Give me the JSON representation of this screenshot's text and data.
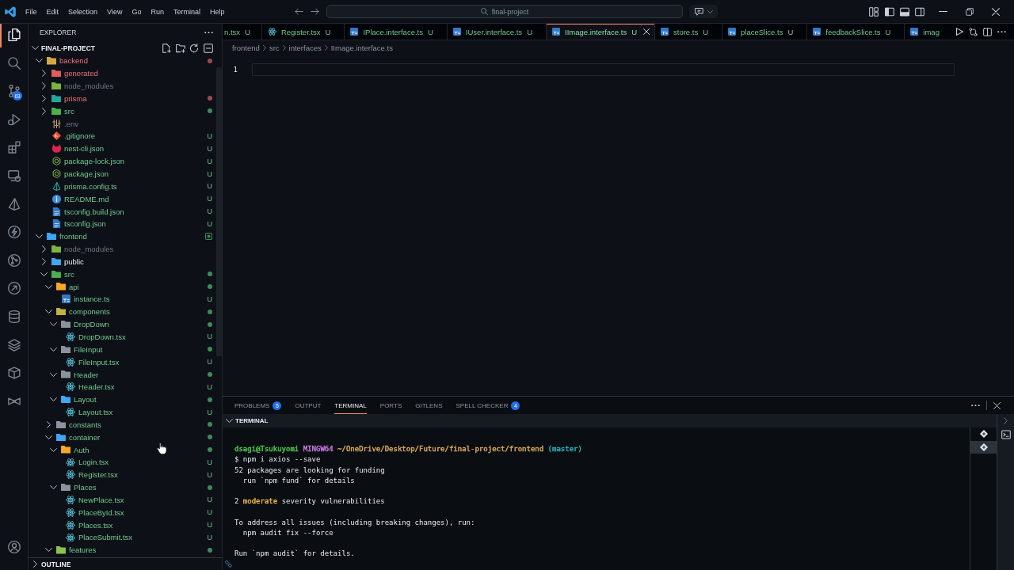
{
  "title_bar": {
    "menu": [
      "File",
      "Edit",
      "Selection",
      "View",
      "Go",
      "Run",
      "Terminal",
      "Help"
    ],
    "command_center": {
      "label": "final-project"
    }
  },
  "activity_bar": {
    "items": [
      {
        "selected": true
      },
      {
        "selected": false
      },
      {
        "selected": false,
        "badge": "63"
      },
      {
        "selected": false
      },
      {
        "selected": false
      },
      {
        "selected": false
      },
      {
        "selected": false
      },
      {
        "selected": false
      },
      {
        "selected": false
      },
      {
        "selected": false
      },
      {
        "selected": false
      },
      {
        "selected": false
      },
      {
        "selected": false
      },
      {
        "selected": false
      }
    ]
  },
  "explorer": {
    "title": "EXPLORER",
    "project": {
      "label": "FINAL-PROJECT",
      "expanded": true
    },
    "tree": [
      {
        "name": "backend",
        "kind": "folder",
        "color": "#d9a740",
        "expanded": true,
        "untracked": false,
        "ignored": false,
        "error": true,
        "dot": true,
        "boxed": false,
        "children": [
          {
            "name": "generated",
            "kind": "folder",
            "color": "#e05d5d",
            "expanded": false,
            "untracked": false,
            "ignored": false,
            "error": true,
            "dot": false,
            "boxed": false
          },
          {
            "name": "node_modules",
            "kind": "folder",
            "color": "#7cb342",
            "expanded": false,
            "untracked": false,
            "ignored": true,
            "error": false,
            "dot": false,
            "boxed": false
          },
          {
            "name": "prisma",
            "kind": "folder",
            "color": "#26a69a",
            "expanded": false,
            "untracked": false,
            "ignored": false,
            "error": true,
            "dot": true,
            "boxed": false
          },
          {
            "name": "src",
            "kind": "folder",
            "color": "#4caf50",
            "expanded": false,
            "untracked": true,
            "ignored": false,
            "error": false,
            "dot": true,
            "boxed": false
          },
          {
            "name": ".env",
            "kind": "env",
            "untracked": false,
            "ignored": true,
            "error": false,
            "dot": false,
            "boxed": false
          },
          {
            "name": ".gitignore",
            "kind": "git",
            "untracked": true,
            "ignored": false,
            "error": false,
            "dot": false,
            "boxed": false,
            "badge": "U"
          },
          {
            "name": "nest-cli.json",
            "kind": "nest",
            "untracked": true,
            "ignored": false,
            "error": false,
            "dot": false,
            "boxed": false,
            "badge": "U"
          },
          {
            "name": "package-lock.json",
            "kind": "npm",
            "untracked": true,
            "ignored": false,
            "error": false,
            "dot": false,
            "boxed": false,
            "badge": "U"
          },
          {
            "name": "package.json",
            "kind": "npm",
            "untracked": true,
            "ignored": false,
            "error": false,
            "dot": false,
            "boxed": false,
            "badge": "U"
          },
          {
            "name": "prisma.config.ts",
            "kind": "prisma",
            "untracked": true,
            "ignored": false,
            "error": false,
            "dot": false,
            "boxed": false,
            "badge": "U"
          },
          {
            "name": "README.md",
            "kind": "info",
            "untracked": true,
            "ignored": false,
            "error": false,
            "dot": false,
            "boxed": false,
            "badge": "U"
          },
          {
            "name": "tsconfig.build.json",
            "kind": "tsconfig",
            "untracked": true,
            "ignored": false,
            "error": false,
            "dot": false,
            "boxed": false,
            "badge": "U"
          },
          {
            "name": "tsconfig.json",
            "kind": "tsconfig",
            "untracked": true,
            "ignored": false,
            "error": false,
            "dot": false,
            "boxed": false,
            "badge": "U"
          }
        ]
      },
      {
        "name": "frontend",
        "kind": "folder",
        "color": "#42a5f5",
        "expanded": true,
        "untracked": true,
        "ignored": false,
        "error": false,
        "dot": true,
        "boxed": true,
        "children": [
          {
            "name": "node_modules",
            "kind": "folder",
            "color": "#7cb342",
            "expanded": false,
            "untracked": false,
            "ignored": true,
            "error": false,
            "dot": false,
            "boxed": false
          },
          {
            "name": "public",
            "kind": "folder",
            "color": "#42a5f5",
            "expanded": false,
            "untracked": false,
            "ignored": false,
            "error": false,
            "dot": false,
            "boxed": false
          },
          {
            "name": "src",
            "kind": "folder",
            "color": "#4caf50",
            "expanded": true,
            "untracked": true,
            "ignored": false,
            "error": false,
            "dot": true,
            "boxed": false,
            "children": [
              {
                "name": "api",
                "kind": "folder",
                "color": "#f9a825",
                "expanded": true,
                "untracked": true,
                "ignored": false,
                "error": false,
                "dot": true,
                "boxed": false,
                "children": [
                  {
                    "name": "instance.ts",
                    "kind": "ts",
                    "untracked": true,
                    "ignored": false,
                    "error": false,
                    "dot": false,
                    "boxed": false,
                    "badge": "U"
                  }
                ]
              },
              {
                "name": "components",
                "kind": "folder",
                "color": "#c0b341",
                "expanded": true,
                "untracked": true,
                "ignored": false,
                "error": false,
                "dot": true,
                "boxed": false,
                "children": [
                  {
                    "name": "DropDown",
                    "kind": "folder",
                    "color": "#8b949e",
                    "expanded": true,
                    "untracked": true,
                    "ignored": false,
                    "error": false,
                    "dot": true,
                    "boxed": false,
                    "children": [
                      {
                        "name": "DropDown.tsx",
                        "kind": "react",
                        "untracked": true,
                        "ignored": false,
                        "error": false,
                        "dot": false,
                        "boxed": false,
                        "badge": "U"
                      }
                    ]
                  },
                  {
                    "name": "FileInput",
                    "kind": "folder",
                    "color": "#8b949e",
                    "expanded": true,
                    "untracked": true,
                    "ignored": false,
                    "error": false,
                    "dot": true,
                    "boxed": false,
                    "children": [
                      {
                        "name": "FileInput.tsx",
                        "kind": "react",
                        "untracked": true,
                        "ignored": false,
                        "error": false,
                        "dot": false,
                        "boxed": false,
                        "badge": "U"
                      }
                    ]
                  },
                  {
                    "name": "Header",
                    "kind": "folder",
                    "color": "#8b949e",
                    "expanded": true,
                    "untracked": true,
                    "ignored": false,
                    "error": false,
                    "dot": true,
                    "boxed": false,
                    "children": [
                      {
                        "name": "Header.tsx",
                        "kind": "react",
                        "untracked": true,
                        "ignored": false,
                        "error": false,
                        "dot": false,
                        "boxed": false,
                        "badge": "U"
                      }
                    ]
                  },
                  {
                    "name": "Layout",
                    "kind": "folder",
                    "color": "#42a5f5",
                    "expanded": true,
                    "untracked": true,
                    "ignored": false,
                    "error": false,
                    "dot": true,
                    "boxed": false,
                    "children": [
                      {
                        "name": "Layout.tsx",
                        "kind": "react",
                        "untracked": true,
                        "ignored": false,
                        "error": false,
                        "dot": false,
                        "boxed": false,
                        "badge": "U"
                      }
                    ]
                  }
                ]
              },
              {
                "name": "constants",
                "kind": "folder",
                "color": "#8b949e",
                "expanded": false,
                "untracked": true,
                "ignored": false,
                "error": false,
                "dot": true,
                "boxed": false
              },
              {
                "name": "container",
                "kind": "folder",
                "color": "#42a5f5",
                "expanded": true,
                "untracked": true,
                "ignored": false,
                "error": false,
                "dot": true,
                "boxed": false,
                "children": [
                  {
                    "name": "Auth",
                    "kind": "folder",
                    "color": "#f9a825",
                    "expanded": true,
                    "untracked": true,
                    "ignored": false,
                    "error": false,
                    "dot": true,
                    "boxed": false,
                    "children": [
                      {
                        "name": "Login.tsx",
                        "kind": "react",
                        "untracked": true,
                        "ignored": false,
                        "error": false,
                        "dot": false,
                        "boxed": false,
                        "badge": "U"
                      },
                      {
                        "name": "Register.tsx",
                        "kind": "react",
                        "untracked": true,
                        "ignored": false,
                        "error": false,
                        "dot": false,
                        "boxed": false,
                        "badge": "U"
                      }
                    ]
                  },
                  {
                    "name": "Places",
                    "kind": "folder",
                    "color": "#8b949e",
                    "expanded": true,
                    "untracked": true,
                    "ignored": false,
                    "error": false,
                    "dot": true,
                    "boxed": false,
                    "children": [
                      {
                        "name": "NewPlace.tsx",
                        "kind": "react",
                        "untracked": true,
                        "ignored": false,
                        "error": false,
                        "dot": false,
                        "boxed": false,
                        "badge": "U"
                      },
                      {
                        "name": "PlaceById.tsx",
                        "kind": "react",
                        "untracked": true,
                        "ignored": false,
                        "error": false,
                        "dot": false,
                        "boxed": false,
                        "badge": "U"
                      },
                      {
                        "name": "Places.tsx",
                        "kind": "react",
                        "untracked": true,
                        "ignored": false,
                        "error": false,
                        "dot": false,
                        "boxed": false,
                        "badge": "U"
                      },
                      {
                        "name": "PlaceSubmit.tsx",
                        "kind": "react",
                        "untracked": true,
                        "ignored": false,
                        "error": false,
                        "dot": false,
                        "boxed": false,
                        "badge": "U"
                      }
                    ]
                  }
                ]
              },
              {
                "name": "features",
                "kind": "folder",
                "color": "#8bc34a",
                "expanded": true,
                "untracked": true,
                "ignored": false,
                "error": false,
                "dot": true,
                "boxed": false
              }
            ]
          }
        ]
      }
    ],
    "outline": {
      "label": "OUTLINE",
      "expanded": false
    }
  },
  "editor": {
    "tabs": [
      {
        "label": "n.tsx",
        "untracked": true,
        "badge": "U",
        "selected": false
      },
      {
        "label": "Register.tsx",
        "kind": "react",
        "untracked": true,
        "badge": "U",
        "selected": false
      },
      {
        "label": "IPlace.interface.ts",
        "kind": "ts",
        "untracked": true,
        "badge": "U",
        "selected": false
      },
      {
        "label": "IUser.interface.ts",
        "kind": "ts",
        "untracked": true,
        "badge": "U",
        "selected": false
      },
      {
        "label": "IImage.interface.ts",
        "kind": "ts",
        "untracked": true,
        "badge": "U",
        "selected": true
      },
      {
        "label": "store.ts",
        "kind": "ts",
        "untracked": true,
        "badge": "U",
        "selected": false
      },
      {
        "label": "placeSlice.ts",
        "kind": "ts",
        "untracked": true,
        "badge": "U",
        "selected": false
      },
      {
        "label": "feedbackSlice.ts",
        "kind": "ts",
        "untracked": true,
        "badge": "U",
        "selected": false
      },
      {
        "label": "imag",
        "kind": "ts",
        "untracked": true,
        "selected": false
      }
    ],
    "breadcrumbs": [
      "frontend",
      "src",
      "interfaces",
      "IImage.interface.ts"
    ],
    "lines": [
      {
        "number": "1",
        "current": true
      }
    ]
  },
  "panel": {
    "tabs": [
      {
        "label": "PROBLEMS",
        "badge": "5",
        "selected": false
      },
      {
        "label": "OUTPUT",
        "selected": false
      },
      {
        "label": "TERMINAL",
        "selected": true
      },
      {
        "label": "PORTS",
        "selected": false
      },
      {
        "label": "GITLENS",
        "selected": false
      },
      {
        "label": "SPELL CHECKER",
        "badge": "4",
        "selected": false
      }
    ],
    "terminal": {
      "title": "TERMINAL",
      "expanded": true,
      "lines": [
        {
          "kind": "blank"
        },
        {
          "kind": "text",
          "segments": [
            {
              "text": "dsagi@Tsukuyomi",
              "color": "#4ec94e"
            },
            {
              "text": "MINGW64",
              "color": "#c678dd"
            },
            {
              "text": "~/OneDrive/Desktop/Future/final-project/frontend",
              "color": "#d7a95c"
            },
            {
              "text": "(master)",
              "color": "#2bb5c1"
            }
          ]
        },
        {
          "kind": "text",
          "segments": [
            {
              "text": "$ npm i axios --save"
            }
          ]
        },
        {
          "kind": "text",
          "segments": [
            {
              "text": "52 packages are looking for funding"
            }
          ]
        },
        {
          "kind": "text",
          "segments": [
            {
              "text": "  run `npm fund` for details"
            }
          ]
        },
        {
          "kind": "blank"
        },
        {
          "kind": "text",
          "segments": [
            {
              "text": "2"
            },
            {
              "text": "moderate",
              "color": "#e5b449"
            },
            {
              "text": "severity vulnerabilities"
            }
          ]
        },
        {
          "kind": "blank"
        },
        {
          "kind": "text",
          "segments": [
            {
              "text": "To address all issues (including breaking changes), run:"
            }
          ]
        },
        {
          "kind": "text",
          "segments": [
            {
              "text": "  npm audit fix --force"
            }
          ]
        },
        {
          "kind": "blank"
        },
        {
          "kind": "text",
          "segments": [
            {
              "text": "Run `npm audit` for details."
            }
          ]
        }
      ],
      "instances": [
        {
          "selected": false
        },
        {
          "selected": true
        }
      ]
    }
  }
}
